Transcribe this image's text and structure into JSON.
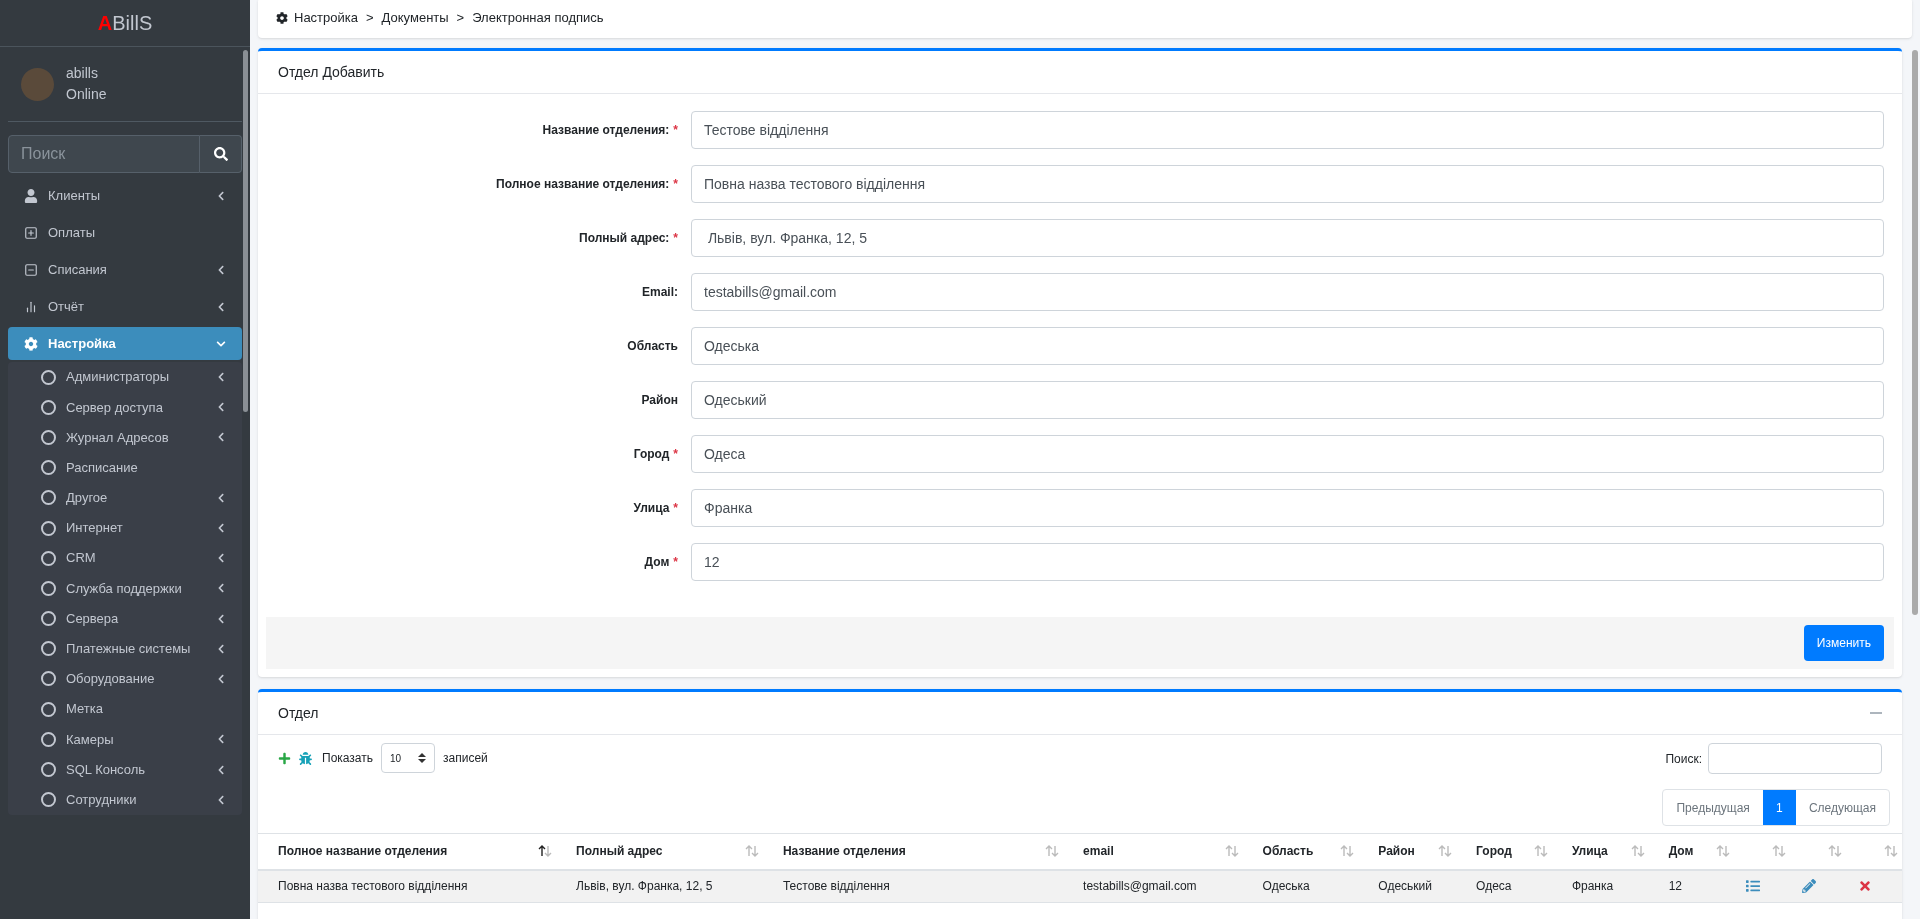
{
  "sidebar": {
    "logo_accent": "A",
    "logo_rest": "BillS",
    "user": {
      "name": "abills",
      "status": "Online"
    },
    "search": {
      "placeholder": "Поиск"
    },
    "items": [
      {
        "label": "Клиенты",
        "expandable": true,
        "expanded": false,
        "selected": false
      },
      {
        "label": "Оплаты",
        "expandable": false,
        "selected": false
      },
      {
        "label": "Списания",
        "expandable": true,
        "expanded": false,
        "selected": false
      },
      {
        "label": "Отчёт",
        "expandable": true,
        "expanded": false,
        "selected": false
      },
      {
        "label": "Настройка",
        "expandable": true,
        "expanded": true,
        "selected": true,
        "children": [
          {
            "label": "Администраторы",
            "expandable": true
          },
          {
            "label": "Сервер доступа",
            "expandable": true
          },
          {
            "label": "Журнал Адресов",
            "expandable": true
          },
          {
            "label": "Расписание",
            "expandable": false
          },
          {
            "label": "Другое",
            "expandable": true
          },
          {
            "label": "Интернет",
            "expandable": true
          },
          {
            "label": "CRM",
            "expandable": true
          },
          {
            "label": "Служба поддержки",
            "expandable": true
          },
          {
            "label": "Сервера",
            "expandable": true
          },
          {
            "label": "Платежные системы",
            "expandable": true
          },
          {
            "label": "Оборудование",
            "expandable": true
          },
          {
            "label": "Метка",
            "expandable": false
          },
          {
            "label": "Камеры",
            "expandable": true
          },
          {
            "label": "SQL Консоль",
            "expandable": true
          },
          {
            "label": "Сотрудники",
            "expandable": true
          }
        ]
      }
    ]
  },
  "breadcrumb": {
    "separator": ">",
    "items": [
      "Настройка",
      "Документы",
      "Электронная подпись"
    ]
  },
  "form": {
    "title": "Отдел Добавить",
    "required_mark": "*",
    "fields": [
      {
        "label": "Название отделения:",
        "required": true,
        "value": "Тестове відділення"
      },
      {
        "label": "Полное название отделения:",
        "required": true,
        "value": "Повна назва тестового відділення"
      },
      {
        "label": "Полный адрес:",
        "required": true,
        "value": " Львів, вул. Франка, 12, 5"
      },
      {
        "label": "Email:",
        "required": false,
        "value": "testabills@gmail.com"
      },
      {
        "label": "Область",
        "required": false,
        "value": "Одеська"
      },
      {
        "label": "Район",
        "required": false,
        "value": "Одеський"
      },
      {
        "label": "Город",
        "required": true,
        "value": "Одеса"
      },
      {
        "label": "Улица",
        "required": true,
        "value": "Франка"
      },
      {
        "label": "Дом",
        "required": true,
        "value": "12"
      }
    ],
    "submit": "Изменить"
  },
  "table_panel": {
    "title": "Отдел",
    "show_label": "Показать",
    "page_size": "10",
    "records_label": "записей",
    "search_label": "Поиск:",
    "pagination": {
      "previous": "Предыдущая",
      "pages": [
        {
          "label": "1",
          "selected": true
        }
      ],
      "next": "Следующая"
    },
    "columns": [
      {
        "label": "Полное название отделения",
        "sorted": true
      },
      {
        "label": "Полный адрес",
        "sorted": false
      },
      {
        "label": "Название отделения",
        "sorted": false
      },
      {
        "label": "email",
        "sorted": false
      },
      {
        "label": "Область",
        "sorted": false
      },
      {
        "label": "Район",
        "sorted": false
      },
      {
        "label": "Город",
        "sorted": false
      },
      {
        "label": "Улица",
        "sorted": false
      },
      {
        "label": "Дом",
        "sorted": false
      },
      {
        "sorted": false
      },
      {
        "sorted": false
      },
      {
        "sorted": false
      }
    ],
    "rows": [
      [
        "Повна назва тестового відділення",
        "Львів, вул. Франка, 12, 5",
        "Тестове відділення",
        "testabills@gmail.com",
        "Одеська",
        "Одеський",
        "Одеса",
        "Франка",
        "12"
      ]
    ]
  }
}
